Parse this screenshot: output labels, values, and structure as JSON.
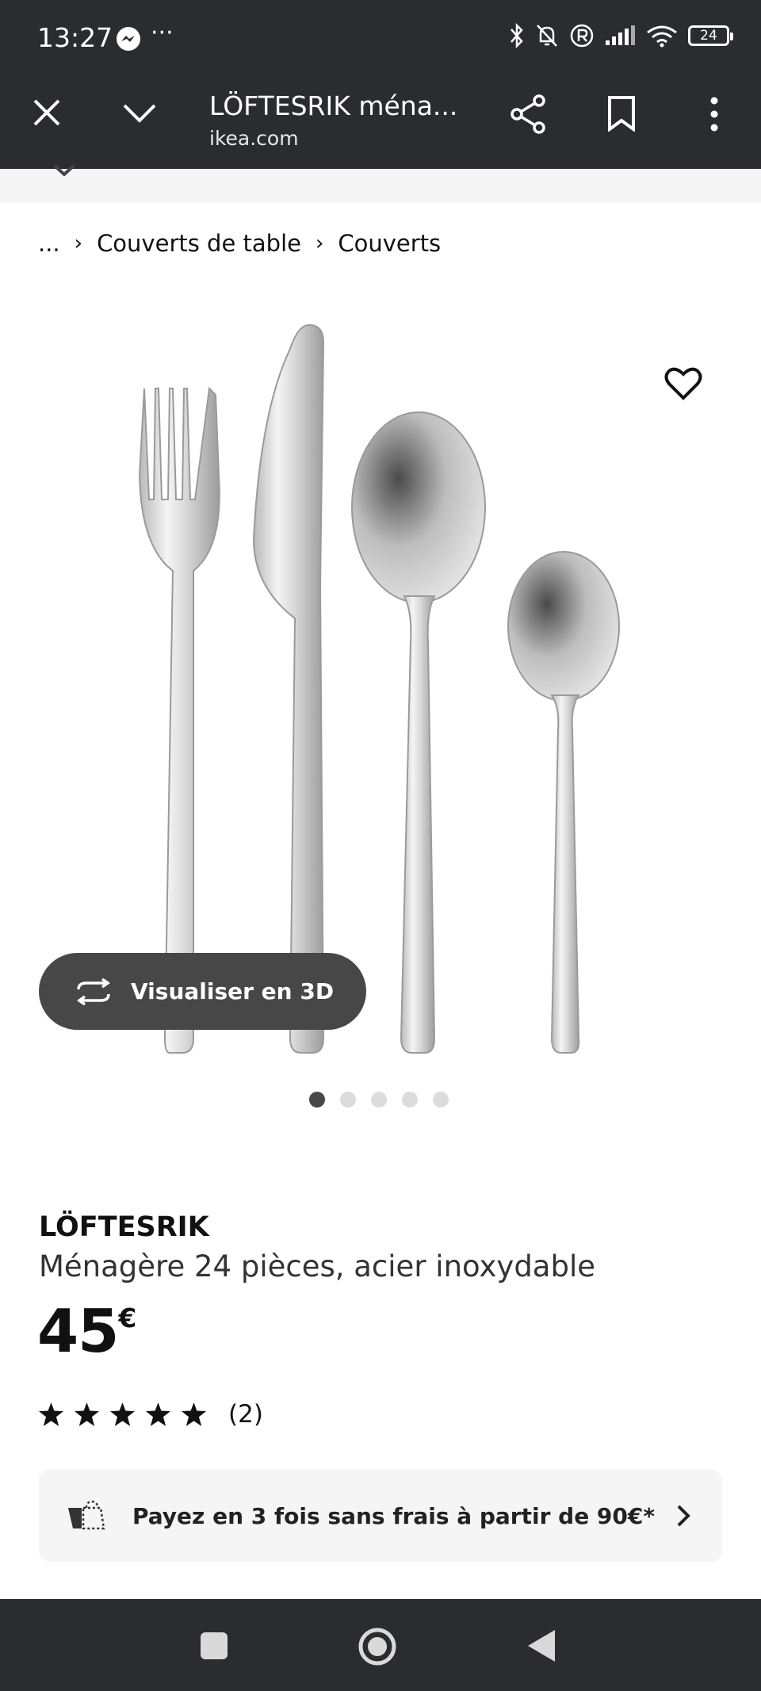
{
  "status_bar": {
    "time": "13:27",
    "more": "···",
    "battery": "24",
    "icons": [
      "messenger-icon",
      "bluetooth-icon",
      "bell-off-icon",
      "registered-icon",
      "signal-icon",
      "wifi-icon",
      "battery-icon"
    ]
  },
  "toolbar": {
    "title": "LÖFTESRIK ména...",
    "url": "ikea.com",
    "icons": [
      "close-icon",
      "chevron-down-icon",
      "share-icon",
      "bookmark-icon",
      "more-vert-icon"
    ]
  },
  "breadcrumb": {
    "ellipsis": "...",
    "items": [
      "Couverts de table",
      "Couverts"
    ]
  },
  "product": {
    "image_description_icon": "cutlery-set-image",
    "visualize_3d_label": "Visualiser en 3D",
    "carousel": {
      "total": 5,
      "active": 1
    },
    "name": "LÖFTESRIK",
    "description": "Ménagère 24 pièces, acier inoxydable",
    "price_value": "45",
    "price_currency": "€",
    "rating": {
      "stars": 5,
      "count": "(2)"
    }
  },
  "payment_banner": {
    "label": "Payez en 3 fois sans frais à partir de 90€*"
  },
  "colors": {
    "chrome": "#2b2c30",
    "pill": "#474747",
    "banner_bg": "#f5f5f5"
  }
}
